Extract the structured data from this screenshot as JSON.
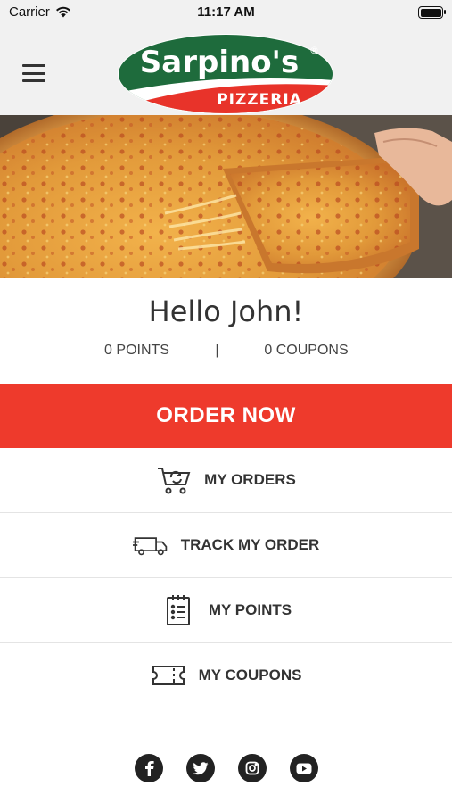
{
  "status_bar": {
    "carrier": "Carrier",
    "time": "11:17 AM"
  },
  "logo": {
    "brand": "Sarpino's",
    "sub": "PIZZERIA",
    "mark": "®",
    "green": "#1e6b3c",
    "red": "#e8332a"
  },
  "greeting": "Hello John!",
  "stats": {
    "points": "0 POINTS",
    "separator": "|",
    "coupons": "0 COUPONS"
  },
  "order_button": "ORDER NOW",
  "menu": {
    "my_orders": "MY ORDERS",
    "track_order": "TRACK MY ORDER",
    "my_points": "MY POINTS",
    "my_coupons": "MY COUPONS"
  },
  "icons": {
    "menu": "hamburger-icon",
    "orders": "shopping-cart-refresh-icon",
    "track": "delivery-truck-icon",
    "points": "notepad-list-icon",
    "coupons": "ticket-icon",
    "social": [
      "facebook-icon",
      "twitter-icon",
      "instagram-icon",
      "youtube-icon"
    ]
  },
  "colors": {
    "accent": "#ee3a2c",
    "header_bg": "#f1f1f1",
    "text": "#333333"
  }
}
